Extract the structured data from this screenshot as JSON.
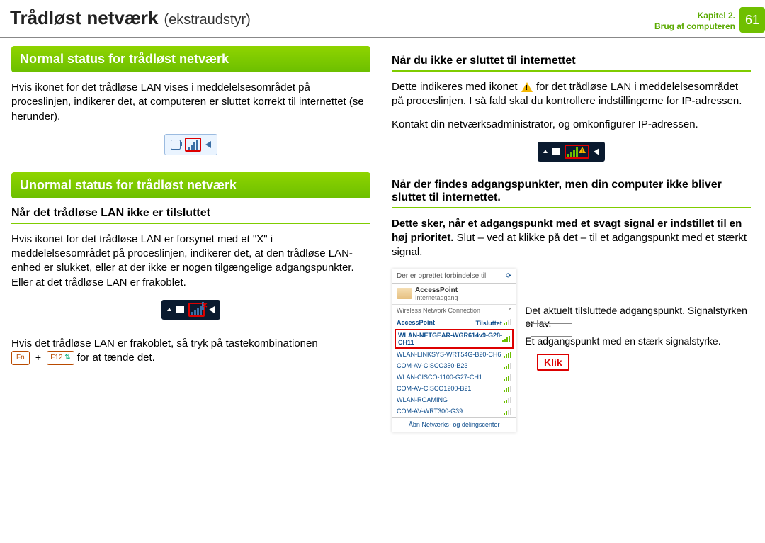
{
  "header": {
    "title_main": "Trådløst netværk",
    "title_sub": "(ekstraudstyr)",
    "chapter_line1": "Kapitel 2.",
    "chapter_line2": "Brug af computeren",
    "page_number": "61"
  },
  "left": {
    "section1_title": "Normal status for trådløst netværk",
    "section1_body": "Hvis ikonet for det trådløse LAN vises i meddelelsesområdet på proceslinjen, indikerer det, at computeren er sluttet korrekt til internettet (se herunder).",
    "section2_title": "Unormal status for trådløst netværk",
    "sub1_title": "Når det trådløse LAN ikke er tilsluttet",
    "sub1_body": "Hvis ikonet for det trådløse LAN er forsynet med et \"X\" i meddelelsesområdet på proceslinjen, indikerer det, at den trådløse LAN-enhed er slukket, eller at der ikke er nogen tilgængelige adgangspunkter. Eller at det trådløse LAN er frakoblet.",
    "keycombo_prefix": "Hvis det trådløse LAN er frakoblet, så tryk på tastekombinationen",
    "key_fn": "Fn",
    "key_f12": "F12",
    "keycombo_suffix": " for at tænde det."
  },
  "right": {
    "sub2_title": "Når du ikke er sluttet til internettet",
    "sub2_body_a": "Dette indikeres med ikonet ",
    "sub2_body_b": " for det trådløse LAN i meddelelsesområdet på proceslinjen. I så fald skal du kontrollere indstillingerne for IP-adressen.",
    "sub2_body2": "Kontakt din netværksadministrator, og omkonfigurer IP-adressen.",
    "sub3_title": "Når der findes adgangspunkter, men din computer ikke bliver sluttet til internettet.",
    "sub3_body_a": "Dette sker, når et adgangspunkt med et svagt signal er indstillet til en høj prioritet.",
    "sub3_body_b": " Slut – ved at klikke på det – til et adgangspunkt med et stærkt signal.",
    "popup": {
      "header_text": "Der er oprettet forbindelse til:",
      "ap_name": "AccessPoint",
      "ap_sub": "Internetadgang",
      "section_label": "Wireless Network Connection",
      "connected_label": "Tilsluttet",
      "items": [
        "AccessPoint",
        "WLAN-NETGEAR-WGR614v9-G28-CH11",
        "WLAN-LINKSYS-WRT54G-B20-CH6",
        "COM-AV-CISCO350-B23",
        "WLAN-CISCO-1100-G27-CH1",
        "COM-AV-CISCO1200-B21",
        "WLAN-ROAMING",
        "COM-AV-WRT300-G39"
      ],
      "footer": "Åbn Netværks- og delingscenter"
    },
    "klik_label": "Klik",
    "annotation1": "Det aktuelt tilsluttede adgangspunkt. Signalstyrken er lav.",
    "annotation2": "Et adgangspunkt med en stærk signalstyrke."
  }
}
